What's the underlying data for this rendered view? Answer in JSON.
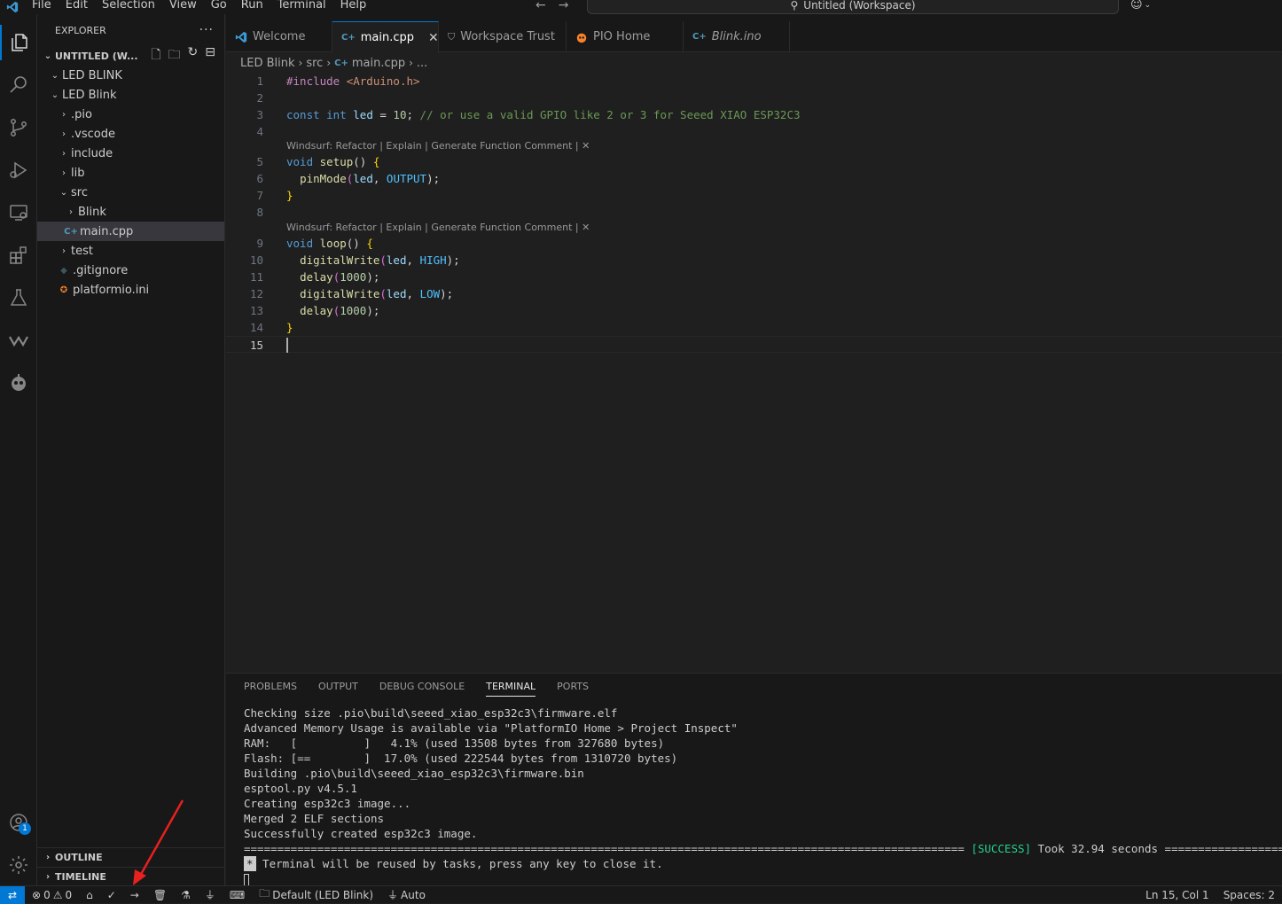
{
  "menu": [
    "File",
    "Edit",
    "Selection",
    "View",
    "Go",
    "Run",
    "Terminal",
    "Help"
  ],
  "command_center": "Untitled (Workspace)",
  "explorer": {
    "title": "EXPLORER",
    "more": "···",
    "workspace": "UNTITLED (W...",
    "tree": [
      {
        "label": "LED BLINK",
        "depth": 1,
        "chev": "⌄"
      },
      {
        "label": "LED Blink",
        "depth": 1,
        "chev": "⌄"
      },
      {
        "label": ".pio",
        "depth": 2,
        "chev": "›"
      },
      {
        "label": ".vscode",
        "depth": 2,
        "chev": "›"
      },
      {
        "label": "include",
        "depth": 2,
        "chev": "›"
      },
      {
        "label": "lib",
        "depth": 2,
        "chev": "›"
      },
      {
        "label": "src",
        "depth": 2,
        "chev": "⌄"
      },
      {
        "label": "Blink",
        "depth": 3,
        "chev": "›"
      },
      {
        "label": "main.cpp",
        "depth": 3,
        "icon": "C+",
        "selected": true
      },
      {
        "label": "test",
        "depth": 2,
        "chev": "›"
      },
      {
        "label": ".gitignore",
        "depth": 2,
        "icon": "◆"
      },
      {
        "label": "platformio.ini",
        "depth": 2,
        "icon": "✪"
      }
    ],
    "outline": "OUTLINE",
    "timeline": "TIMELINE"
  },
  "tabs": [
    {
      "label": "Welcome",
      "icon": "vscode"
    },
    {
      "label": "main.cpp",
      "icon": "C+",
      "active": true,
      "close": "✕"
    },
    {
      "label": "Workspace Trust",
      "icon": "⛉"
    },
    {
      "label": "PIO Home",
      "icon": "pio"
    },
    {
      "label": "Blink.ino",
      "icon": "C+",
      "italic": true
    }
  ],
  "breadcrumb": [
    "LED Blink",
    "src",
    "main.cpp",
    "..."
  ],
  "code_lens": "Windsurf: Refactor | Explain | Generate Function Comment | ✕",
  "line_numbers": [
    "1",
    "2",
    "3",
    "4",
    "5",
    "6",
    "7",
    "8",
    "9",
    "10",
    "11",
    "12",
    "13",
    "14",
    "15"
  ],
  "code": {
    "l1_a": "#include ",
    "l1_b": "<Arduino.h>",
    "l3_kw1": "const ",
    "l3_kw2": "int ",
    "l3_var": "led",
    "l3_eq": " = ",
    "l3_num": "10",
    "l3_semi": "; ",
    "l3_com": "// or use a valid GPIO like 2 or 3 for Seeed XIAO ESP32C3",
    "l5_kw": "void ",
    "l5_fn": "setup",
    "l5_par": "() ",
    "l5_br": "{",
    "l6_fn": "pinMode",
    "l6_open": "(",
    "l6_var": "led",
    "l6_com": ", ",
    "l6_const": "OUTPUT",
    "l6_close": ");",
    "l7_br": "}",
    "l9_kw": "void ",
    "l9_fn": "loop",
    "l9_par": "() ",
    "l9_br": "{",
    "l10_fn": "digitalWrite",
    "l10_var": "led",
    "l10_const": "HIGH",
    "l11_fn": "delay",
    "l11_num": "1000",
    "l12_fn": "digitalWrite",
    "l12_var": "led",
    "l12_const": "LOW",
    "l13_fn": "delay",
    "l13_num": "1000",
    "l14_br": "}",
    "open_paren": "(",
    "close_semi": ");",
    "comma": ", "
  },
  "panel": {
    "tabs": [
      "PROBLEMS",
      "OUTPUT",
      "DEBUG CONSOLE",
      "TERMINAL",
      "PORTS"
    ],
    "active_tab": "TERMINAL",
    "terminal": [
      "Checking size .pio\\build\\seeed_xiao_esp32c3\\firmware.elf",
      "Advanced Memory Usage is available via \"PlatformIO Home > Project Inspect\"",
      "RAM:   [          ]   4.1% (used 13508 bytes from 327680 bytes)",
      "Flash: [==        ]  17.0% (used 222544 bytes from 1310720 bytes)",
      "Building .pio\\build\\seeed_xiao_esp32c3\\firmware.bin",
      "esptool.py v4.5.1",
      "Creating esp32c3 image...",
      "Merged 2 ELF sections",
      "Successfully created esp32c3 image."
    ],
    "success_left": "============================================================================================================ ",
    "success_word": "[SUCCESS]",
    "success_right": " Took 32.94 seconds ==================================================",
    "star": "*",
    "reuse": " Terminal will be reused by tasks, press any key to close it."
  },
  "status": {
    "errors": "0",
    "warnings": "0",
    "env": "Default (LED Blink)",
    "port": "Auto",
    "position": "Ln 15, Col 1",
    "spaces": "Spaces: 2"
  },
  "account_badge": "1",
  "colors": {
    "accent": "#0078d4",
    "arrow": "#e8201f",
    "success": "#23d18b"
  }
}
